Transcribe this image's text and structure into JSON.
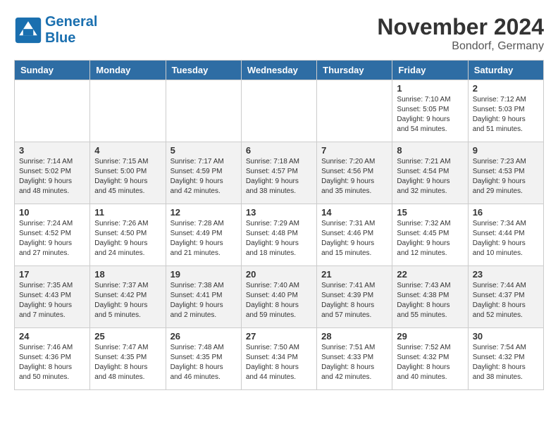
{
  "header": {
    "logo_line1": "General",
    "logo_line2": "Blue",
    "month_title": "November 2024",
    "location": "Bondorf, Germany"
  },
  "days_of_week": [
    "Sunday",
    "Monday",
    "Tuesday",
    "Wednesday",
    "Thursday",
    "Friday",
    "Saturday"
  ],
  "weeks": [
    [
      {
        "day": "",
        "info": ""
      },
      {
        "day": "",
        "info": ""
      },
      {
        "day": "",
        "info": ""
      },
      {
        "day": "",
        "info": ""
      },
      {
        "day": "",
        "info": ""
      },
      {
        "day": "1",
        "info": "Sunrise: 7:10 AM\nSunset: 5:05 PM\nDaylight: 9 hours\nand 54 minutes."
      },
      {
        "day": "2",
        "info": "Sunrise: 7:12 AM\nSunset: 5:03 PM\nDaylight: 9 hours\nand 51 minutes."
      }
    ],
    [
      {
        "day": "3",
        "info": "Sunrise: 7:14 AM\nSunset: 5:02 PM\nDaylight: 9 hours\nand 48 minutes."
      },
      {
        "day": "4",
        "info": "Sunrise: 7:15 AM\nSunset: 5:00 PM\nDaylight: 9 hours\nand 45 minutes."
      },
      {
        "day": "5",
        "info": "Sunrise: 7:17 AM\nSunset: 4:59 PM\nDaylight: 9 hours\nand 42 minutes."
      },
      {
        "day": "6",
        "info": "Sunrise: 7:18 AM\nSunset: 4:57 PM\nDaylight: 9 hours\nand 38 minutes."
      },
      {
        "day": "7",
        "info": "Sunrise: 7:20 AM\nSunset: 4:56 PM\nDaylight: 9 hours\nand 35 minutes."
      },
      {
        "day": "8",
        "info": "Sunrise: 7:21 AM\nSunset: 4:54 PM\nDaylight: 9 hours\nand 32 minutes."
      },
      {
        "day": "9",
        "info": "Sunrise: 7:23 AM\nSunset: 4:53 PM\nDaylight: 9 hours\nand 29 minutes."
      }
    ],
    [
      {
        "day": "10",
        "info": "Sunrise: 7:24 AM\nSunset: 4:52 PM\nDaylight: 9 hours\nand 27 minutes."
      },
      {
        "day": "11",
        "info": "Sunrise: 7:26 AM\nSunset: 4:50 PM\nDaylight: 9 hours\nand 24 minutes."
      },
      {
        "day": "12",
        "info": "Sunrise: 7:28 AM\nSunset: 4:49 PM\nDaylight: 9 hours\nand 21 minutes."
      },
      {
        "day": "13",
        "info": "Sunrise: 7:29 AM\nSunset: 4:48 PM\nDaylight: 9 hours\nand 18 minutes."
      },
      {
        "day": "14",
        "info": "Sunrise: 7:31 AM\nSunset: 4:46 PM\nDaylight: 9 hours\nand 15 minutes."
      },
      {
        "day": "15",
        "info": "Sunrise: 7:32 AM\nSunset: 4:45 PM\nDaylight: 9 hours\nand 12 minutes."
      },
      {
        "day": "16",
        "info": "Sunrise: 7:34 AM\nSunset: 4:44 PM\nDaylight: 9 hours\nand 10 minutes."
      }
    ],
    [
      {
        "day": "17",
        "info": "Sunrise: 7:35 AM\nSunset: 4:43 PM\nDaylight: 9 hours\nand 7 minutes."
      },
      {
        "day": "18",
        "info": "Sunrise: 7:37 AM\nSunset: 4:42 PM\nDaylight: 9 hours\nand 5 minutes."
      },
      {
        "day": "19",
        "info": "Sunrise: 7:38 AM\nSunset: 4:41 PM\nDaylight: 9 hours\nand 2 minutes."
      },
      {
        "day": "20",
        "info": "Sunrise: 7:40 AM\nSunset: 4:40 PM\nDaylight: 8 hours\nand 59 minutes."
      },
      {
        "day": "21",
        "info": "Sunrise: 7:41 AM\nSunset: 4:39 PM\nDaylight: 8 hours\nand 57 minutes."
      },
      {
        "day": "22",
        "info": "Sunrise: 7:43 AM\nSunset: 4:38 PM\nDaylight: 8 hours\nand 55 minutes."
      },
      {
        "day": "23",
        "info": "Sunrise: 7:44 AM\nSunset: 4:37 PM\nDaylight: 8 hours\nand 52 minutes."
      }
    ],
    [
      {
        "day": "24",
        "info": "Sunrise: 7:46 AM\nSunset: 4:36 PM\nDaylight: 8 hours\nand 50 minutes."
      },
      {
        "day": "25",
        "info": "Sunrise: 7:47 AM\nSunset: 4:35 PM\nDaylight: 8 hours\nand 48 minutes."
      },
      {
        "day": "26",
        "info": "Sunrise: 7:48 AM\nSunset: 4:35 PM\nDaylight: 8 hours\nand 46 minutes."
      },
      {
        "day": "27",
        "info": "Sunrise: 7:50 AM\nSunset: 4:34 PM\nDaylight: 8 hours\nand 44 minutes."
      },
      {
        "day": "28",
        "info": "Sunrise: 7:51 AM\nSunset: 4:33 PM\nDaylight: 8 hours\nand 42 minutes."
      },
      {
        "day": "29",
        "info": "Sunrise: 7:52 AM\nSunset: 4:32 PM\nDaylight: 8 hours\nand 40 minutes."
      },
      {
        "day": "30",
        "info": "Sunrise: 7:54 AM\nSunset: 4:32 PM\nDaylight: 8 hours\nand 38 minutes."
      }
    ]
  ]
}
